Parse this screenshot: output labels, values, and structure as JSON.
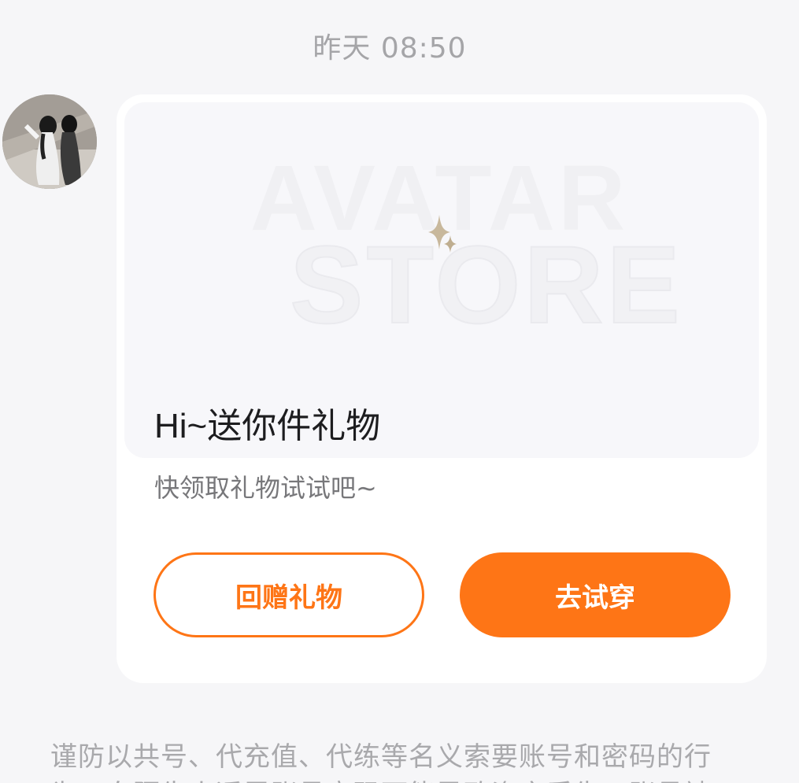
{
  "chat": {
    "timestamp": "昨天 08:50"
  },
  "message": {
    "banner": {
      "line1": "AVATAR",
      "line2": "STORE"
    },
    "title": "Hi~送你件礼物",
    "subtitle": "快领取礼物试试吧~",
    "buttons": {
      "return_gift": "回赠礼物",
      "try_on": "去试穿"
    }
  },
  "notice": {
    "text": "谨防以共号、代充值、代练等名义索要账号和密码的行为，向陌生人透露账号密码可能导致资产丢失、账号被"
  },
  "colors": {
    "accent": "#fe7516",
    "background": "#f6f6f8",
    "card": "#ffffff"
  }
}
